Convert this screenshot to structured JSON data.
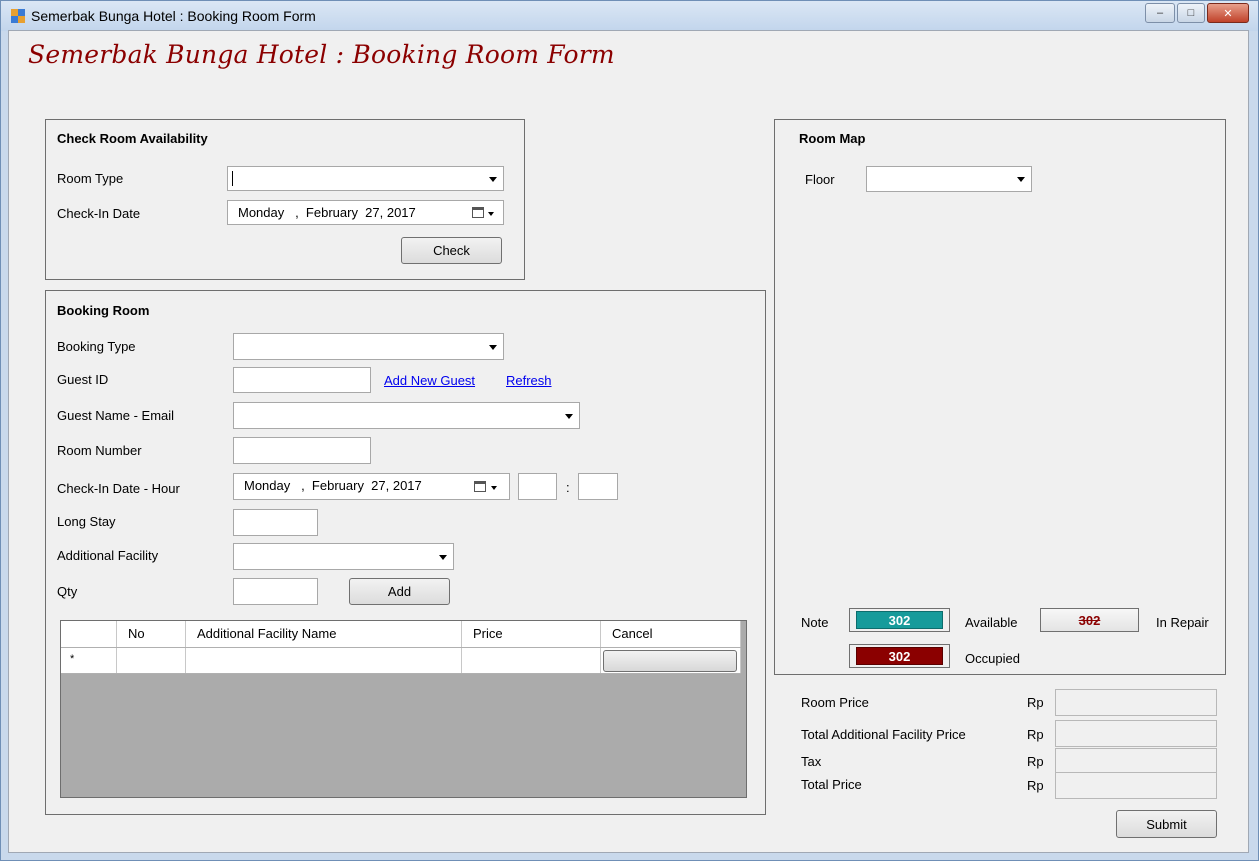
{
  "window": {
    "title": "Semerbak Bunga Hotel : Booking Room Form",
    "minimize_glyph": "–",
    "maximize_glyph": "□",
    "close_glyph": "✕"
  },
  "form_title": "Semerbak Bunga Hotel : Booking Room Form",
  "check_availability": {
    "title": "Check Room Availability",
    "room_type_label": "Room Type",
    "room_type_value": "",
    "checkin_date_label": "Check-In Date",
    "checkin_date_value": "Monday   ,  February  27, 2017",
    "check_button": "Check"
  },
  "booking": {
    "title": "Booking Room",
    "booking_type_label": "Booking Type",
    "booking_type_value": "",
    "guest_id_label": "Guest ID",
    "guest_id_value": "",
    "add_new_guest_link": "Add New Guest",
    "refresh_link": "Refresh",
    "guest_name_label": "Guest Name - Email",
    "guest_name_value": "",
    "room_number_label": "Room Number",
    "room_number_value": "",
    "checkin_datehour_label": "Check-In Date - Hour",
    "checkin_datehour_value": "Monday   ,  February  27, 2017",
    "hour_separator": ":",
    "hour_value": "",
    "minute_value": "",
    "long_stay_label": "Long Stay",
    "long_stay_value": "",
    "additional_facility_label": "Additional Facility",
    "additional_facility_value": "",
    "qty_label": "Qty",
    "qty_value": "",
    "add_button": "Add",
    "grid": {
      "columns": [
        "No",
        "Additional Facility Name",
        "Price",
        "Cancel"
      ],
      "new_row_marker": "*"
    }
  },
  "room_map": {
    "title": "Room Map",
    "floor_label": "Floor",
    "floor_value": "",
    "note_label": "Note",
    "legend": [
      {
        "number": "302",
        "label": "Available",
        "color": "#169b9b"
      },
      {
        "number": "302",
        "label": "In Repair",
        "color": "#f0f0f0"
      },
      {
        "number": "302",
        "label": "Occupied",
        "color": "#8b0000"
      }
    ]
  },
  "pricing": {
    "room_price_label": "Room Price",
    "total_additional_label": "Total Additional Facility Price",
    "tax_label": "Tax",
    "total_price_label": "Total Price",
    "currency": "Rp",
    "room_price_value": "",
    "total_additional_value": "",
    "tax_value": "",
    "total_price_value": ""
  },
  "submit_button": "Submit",
  "colors": {
    "title_red": "#8b0000",
    "available": "#169b9b",
    "occupied": "#8b0000",
    "link_blue": "#0000ee"
  }
}
